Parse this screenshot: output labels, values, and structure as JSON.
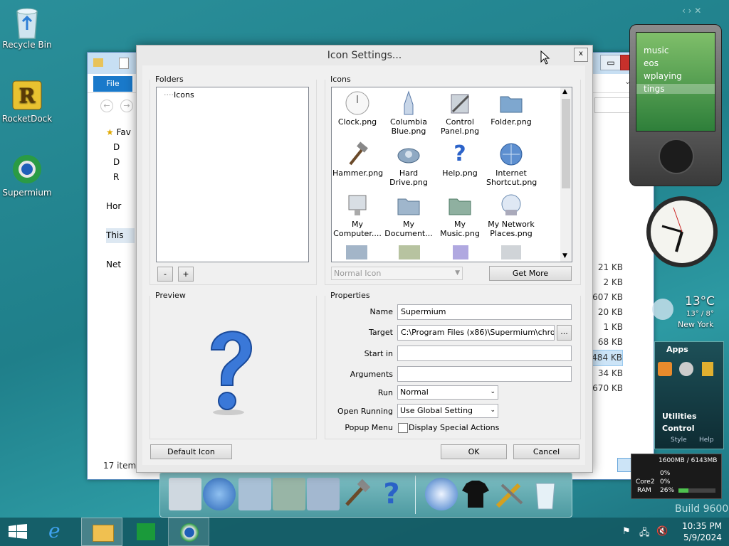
{
  "desktop": {
    "icons": [
      {
        "label": "Recycle Bin",
        "icon": "recycle-bin-icon"
      },
      {
        "label": "RocketDock",
        "icon": "rocketdock-icon"
      },
      {
        "label": "Supermium",
        "icon": "supermium-icon"
      }
    ],
    "build_text": "Build 9600"
  },
  "explorer": {
    "file_tab": "File",
    "nav_items": [
      "Fav",
      "D",
      "D",
      "R",
      "Hor",
      "This",
      "Net"
    ],
    "sizes": [
      "21 KB",
      "2 KB",
      ",607 KB",
      "20 KB",
      "1 KB",
      "68 KB",
      "484 KB",
      "34 KB",
      "670 KB"
    ],
    "status": "17 items"
  },
  "dialog": {
    "title": "Icon Settings...",
    "close": "x",
    "folders_label": "Folders",
    "folder_tree_item": "Icons",
    "minus": "-",
    "plus": "+",
    "icons_label": "Icons",
    "icons": [
      {
        "label": "Clock.png",
        "icon": "clock-icon"
      },
      {
        "label": "Columbia Blue.png",
        "icon": "columbia-shuttle-icon"
      },
      {
        "label": "Control Panel.png",
        "icon": "control-panel-icon"
      },
      {
        "label": "Folder.png",
        "icon": "folder-icon"
      },
      {
        "label": "Hammer.png",
        "icon": "hammer-icon"
      },
      {
        "label": "Hard Drive.png",
        "icon": "hard-drive-icon"
      },
      {
        "label": "Help.png",
        "icon": "help-icon"
      },
      {
        "label": "Internet Shortcut.png",
        "icon": "internet-shortcut-icon"
      },
      {
        "label": "My Computer....",
        "icon": "my-computer-icon"
      },
      {
        "label": "My Document...",
        "icon": "my-documents-icon"
      },
      {
        "label": "My Music.png",
        "icon": "my-music-icon"
      },
      {
        "label": "My Network Places.png",
        "icon": "network-places-icon"
      }
    ],
    "icon_state_select": "Normal Icon",
    "get_more": "Get More",
    "preview_label": "Preview",
    "properties_label": "Properties",
    "name_label": "Name",
    "name_value": "Supermium",
    "target_label": "Target",
    "target_value": "C:\\Program Files (x86)\\Supermium\\chrome.e",
    "browse": "...",
    "startin_label": "Start in",
    "startin_value": "",
    "arguments_label": "Arguments",
    "arguments_value": "",
    "run_label": "Run",
    "run_value": "Normal",
    "open_running_label": "Open Running",
    "open_running_value": "Use Global Setting",
    "popup_menu_label": "Popup Menu",
    "popup_checkbox_label": "Display Special Actions",
    "default_icon": "Default Icon",
    "ok": "OK",
    "cancel": "Cancel"
  },
  "gadgets": {
    "media_items": [
      "music",
      "eos",
      "wplaying",
      "tings"
    ],
    "weather_temp": "13°C",
    "weather_range": "13° / 8°",
    "weather_city": "New York",
    "apps_title": "Apps",
    "utilities": "Utilities",
    "control": "Control",
    "style": "Style",
    "help": "Help",
    "memory": "1600MB / 6143MB",
    "core1_label": "Core2",
    "core1_value": "0%",
    "core0_value": "0%",
    "ram_label": "RAM",
    "ram_value": "26%",
    "ram_fraction": 0.26
  },
  "taskbar": {
    "time": "10:35 PM",
    "date": "5/9/2024"
  },
  "colors": {
    "accent_blue": "#1979ca",
    "taskbar": "#145a64"
  }
}
